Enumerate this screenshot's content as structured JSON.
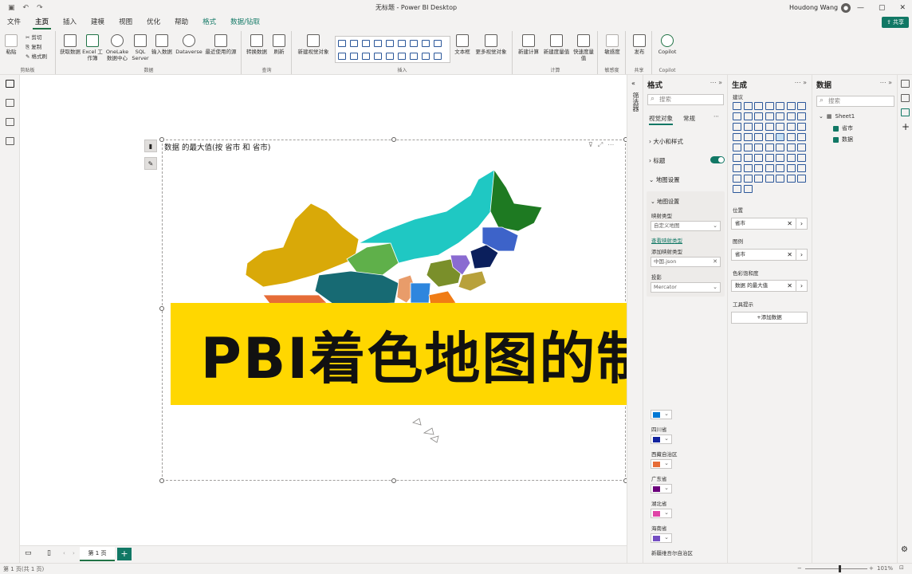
{
  "window": {
    "title": "无标题 - Power BI Desktop",
    "user": "Houdong Wang",
    "share_label": "共享"
  },
  "menu": [
    "文件",
    "主页",
    "插入",
    "建模",
    "视图",
    "优化",
    "帮助",
    "格式",
    "数据/钻取"
  ],
  "ribbon": {
    "clipboard": {
      "label": "剪贴板",
      "paste": "粘贴",
      "cut": "剪切",
      "copy": "复制",
      "format_painter": "格式刷"
    },
    "data": {
      "label": "数据",
      "get_data": "获取数据",
      "excel": "Excel 工作簿",
      "onelake": "OneLake 数据中心",
      "sql": "SQL Server",
      "enter_data": "输入数据",
      "dataverse": "Dataverse",
      "recent": "最近使用的源"
    },
    "query": {
      "label": "查询",
      "transform": "转换数据",
      "refresh": "刷新"
    },
    "insert": {
      "label": "插入",
      "new_visual": "新建视觉对象",
      "text_box": "文本框",
      "more_visuals": "更多视觉对象"
    },
    "calc": {
      "label": "计算",
      "new_measure": "新建计算",
      "new_measure2": "新建度量值",
      "quick_measure": "快速度量值"
    },
    "sensitivity": {
      "label": "敏感度",
      "btn": "敏感度"
    },
    "share": {
      "label": "共享",
      "publish": "发布"
    },
    "copilot": {
      "label": "Copilot",
      "btn": "Copilot"
    }
  },
  "visual": {
    "title": "数据 的最大值(按 省市 和 省市)"
  },
  "banner": "PBI着色地图的制作",
  "filters_label": "筛选器",
  "format_pane": {
    "title": "格式",
    "search_placeholder": "搜索",
    "tab_visual": "视觉对象",
    "tab_general": "常规",
    "size_style": "大小和样式",
    "title_section": "标题",
    "map_settings": "地图设置",
    "map_settings_sub": "地图设置",
    "map_type_label": "映射类型",
    "map_type_value": "自定义地图",
    "view_map_types": "查看映射类型",
    "add_map_type_label": "添加映射类型",
    "add_map_type_value": "中国.json",
    "projection_label": "投影",
    "projection_value": "Mercator",
    "colors": [
      {
        "name": "四川省",
        "color": "#0078d4"
      },
      {
        "name": "西藏自治区",
        "color": "#12239e"
      },
      {
        "name": "广东省",
        "color": "#e66c37"
      },
      {
        "name": "湖北省",
        "color": "#6b007b"
      },
      {
        "name": "海南省",
        "color": "#e044a7"
      },
      {
        "name": "新疆维吾尔自治区",
        "color": "#744ec2"
      }
    ],
    "first_swatch_color": "#0078d4"
  },
  "build_pane": {
    "title": "生成",
    "viz_label": "建议",
    "location_label": "位置",
    "location_value": "省市",
    "legend_label": "图例",
    "legend_value": "省市",
    "saturation_label": "色彩饱和度",
    "saturation_value": "数据 的最大值",
    "tooltips_label": "工具提示",
    "add_data": "+添加数据"
  },
  "data_pane": {
    "title": "数据",
    "search_placeholder": "搜索",
    "table": "Sheet1",
    "fields": [
      "省市",
      "数据"
    ]
  },
  "pages": {
    "tab": "第 1 页",
    "add": "+"
  },
  "status": {
    "page_info": "第 1 页(共 1 页)",
    "zoom": "101%"
  }
}
